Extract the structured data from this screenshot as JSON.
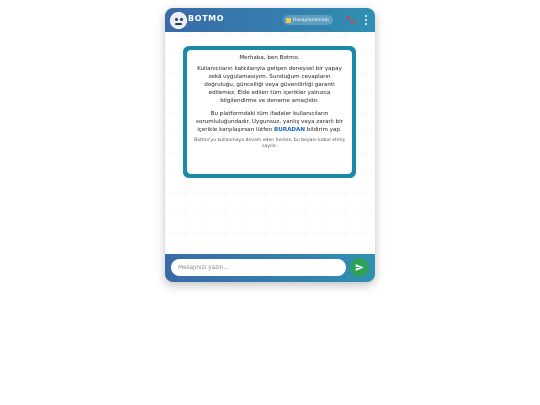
{
  "header": {
    "brand": "BOTMO",
    "badge": "Hesaplanamadı"
  },
  "notice": {
    "intro": "Merhaba, ben Botmo.",
    "body": "Kullanıcıların katkılarıyla gelişen deneysel bir yapay zekâ uygulamasıyım. Sunduğum cevapların doğruluğu, güncelliği veya güvenilirliği garanti edilemez. Elde edilen tüm içerikler yalnızca bilgilendirme ve deneme amaçlıdır.",
    "warning_before": "Bu platformdaki tüm ifadeler kullanıcıların sorumluluğundadır. Uygunsuz, yanlış veya zararlı bir içerikle karşılaşırsan lütfen",
    "link": "BURADAN",
    "warning_after": "bildirim yap.",
    "consent": "Botmo'yu kullanmaya devam eden herkes, bu beyanı kabul etmiş sayılır."
  },
  "composer": {
    "placeholder": "Mesajınızı yazın..."
  },
  "colors": {
    "header_start": "#3a6aa8",
    "header_end": "#2f8fb2",
    "notice_border": "#1b8aa5",
    "link": "#1565c0",
    "phone": "#e53935",
    "send": "#2fa05a"
  },
  "icons": {
    "avatar": "robot-face-icon",
    "badge": "coin-icon",
    "phone": "phone-icon",
    "menu": "kebab-menu-icon",
    "send": "paper-plane-icon"
  }
}
